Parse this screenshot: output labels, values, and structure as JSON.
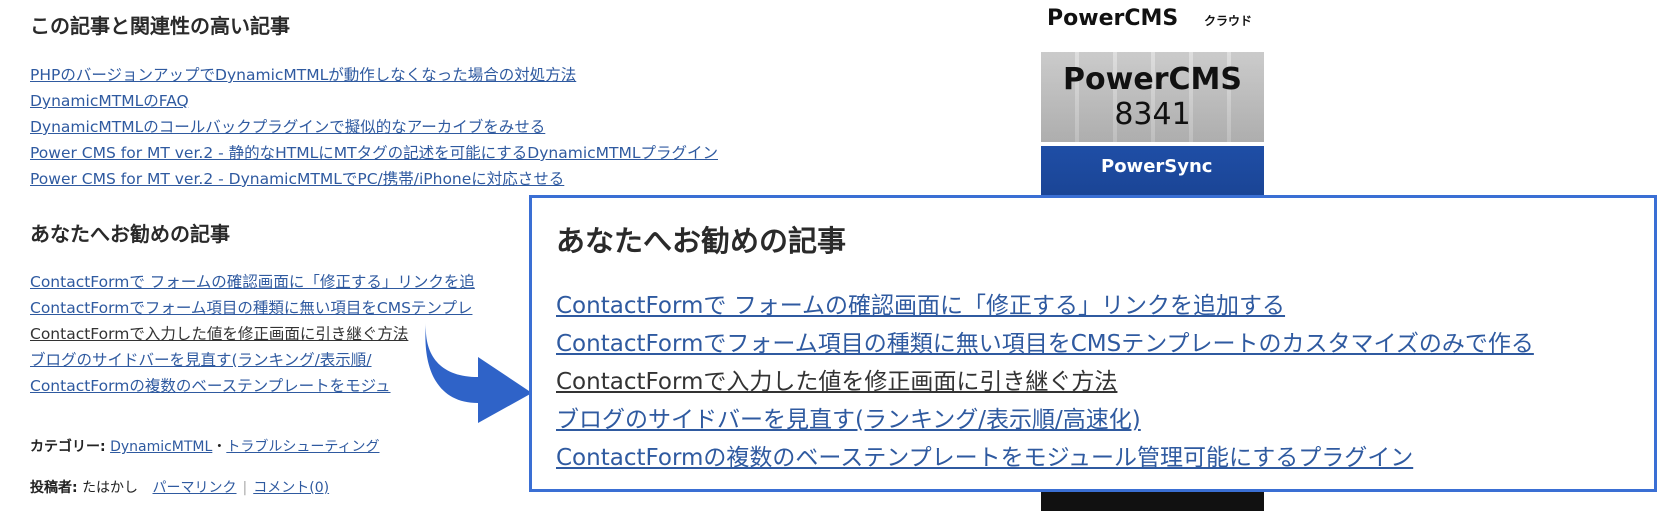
{
  "related": {
    "heading": "この記事と関連性の高い記事",
    "links": [
      "PHPのバージョンアップでDynamicMTMLが動作しなくなった場合の対処方法",
      "DynamicMTMLのFAQ",
      "DynamicMTMLのコールバックプラグインで擬似的なアーカイブをみせる",
      "Power CMS for MT ver.2 - 静的なHTMLにMTタグの記述を可能にするDynamicMTMLプラグイン",
      "Power CMS for MT ver.2 - DynamicMTMLでPC/携帯/iPhoneに対応させる"
    ]
  },
  "recommended": {
    "heading": "あなたへお勧めの記事",
    "links": [
      "ContactFormで フォームの確認画面に「修正する」リンクを追加する",
      "ContactFormでフォーム項目の種類に無い項目をCMSテンプレートのカスタマイズのみで作る",
      "ContactFormで入力した値を修正画面に引き継ぐ方法",
      "ブログのサイドバーを見直す(ランキング/表示順/高速化)",
      "ContactFormの複数のベーステンプレートをモジュール管理可能にするプラグイン"
    ],
    "truncated": [
      "ContactFormで フォームの確認画面に「修正する」リンクを追",
      "ContactFormでフォーム項目の種類に無い項目をCMSテンプレ",
      "ContactFormで入力した値を修正画面に引き継ぐ方法",
      "ブログのサイドバーを見直す(ランキング/表示順/",
      "ContactFormの複数のベーステンプレートをモジュ"
    ]
  },
  "meta": {
    "category_label": "カテゴリー:",
    "category_1": "DynamicMTML",
    "category_dot": "・",
    "category_2": "トラブルシューティング",
    "author_label": "投稿者:",
    "author": "たはかし",
    "permalink": "パーマリンク",
    "divider": "|",
    "comments": "コメント(0)"
  },
  "banners": {
    "cloud_brand": "PowerCMS",
    "cloud_sub": "クラウド",
    "pc8341_brand": "PowerCMS",
    "pc8341_num": "8341",
    "sync_brand": "PowerSync"
  },
  "colors": {
    "link": "#2f5aa0",
    "highlight_border": "#3a6fd4",
    "arrow": "#2f63c8"
  }
}
